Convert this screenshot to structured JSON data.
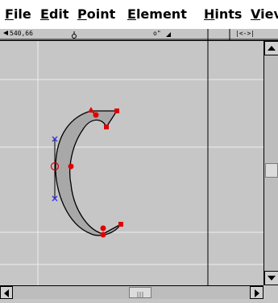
{
  "menubar": {
    "items": [
      {
        "label": "File"
      },
      {
        "label": "Edit"
      },
      {
        "label": "Point"
      },
      {
        "label": "Element"
      },
      {
        "label": "Hints"
      },
      {
        "label": "Viev"
      }
    ]
  },
  "ruler": {
    "coordinates": "540,66",
    "tangent_label": "o\"",
    "width_label": "|<->|"
  },
  "icons": {
    "ruler_origin": "ruler-arrow-icon",
    "ruler_mark": "ruler-circle-icon",
    "scroll_up": "arrow-up-icon",
    "scroll_down": "arrow-down-icon",
    "scroll_left": "arrow-left-icon",
    "scroll_right": "arrow-right-icon"
  },
  "colors": {
    "background": "#c6c6c6",
    "glyph_fill": "#a8a8a8",
    "point_red": "#e00000",
    "point_blue": "#3333dd",
    "grid_line": "#e8e8e8"
  }
}
